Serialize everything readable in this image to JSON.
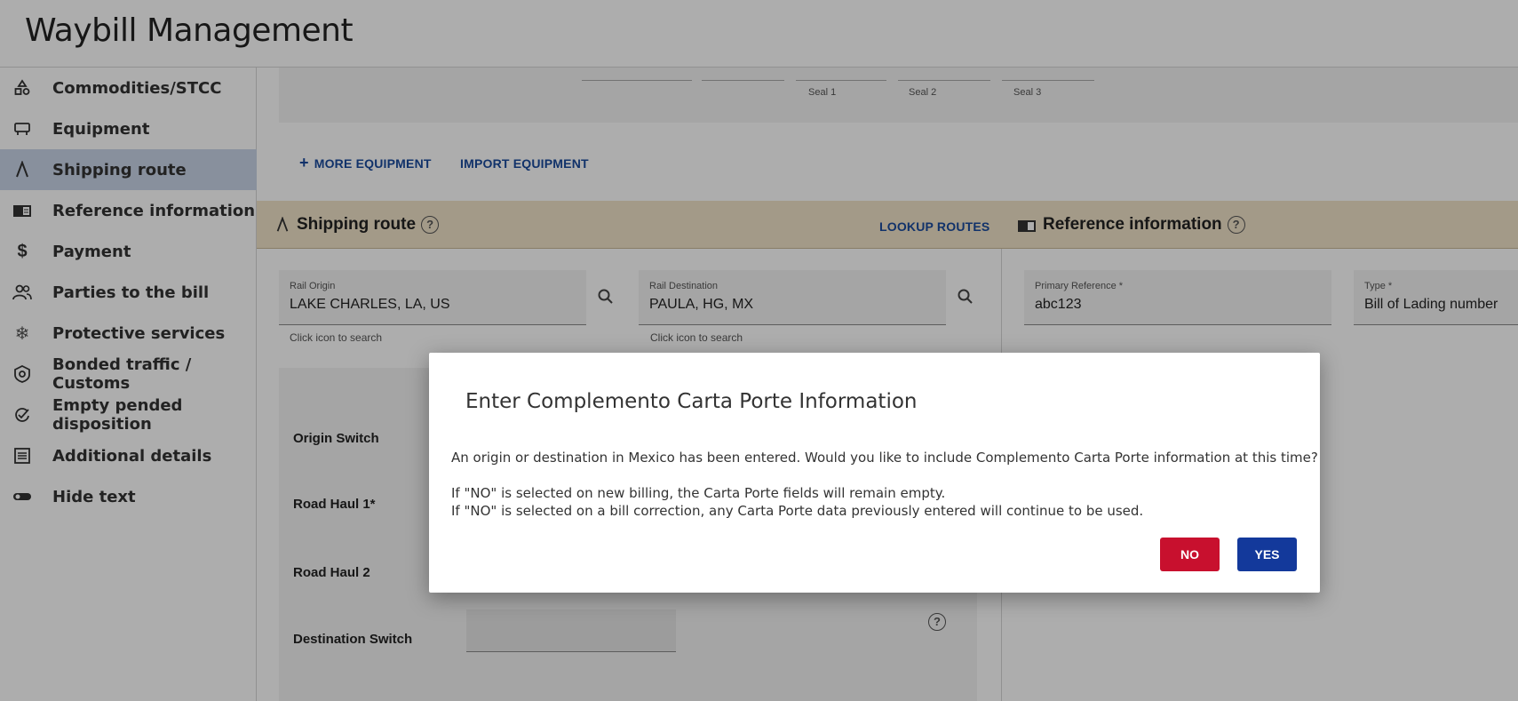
{
  "header": {
    "title": "Waybill Management"
  },
  "sidebar": {
    "items": [
      {
        "label": "Commodities/STCC",
        "icon": "shapes-icon",
        "active": false
      },
      {
        "label": "Equipment",
        "icon": "railcar-icon",
        "active": false
      },
      {
        "label": "Shipping route",
        "icon": "route-icon",
        "active": true
      },
      {
        "label": "Reference information",
        "icon": "book-icon",
        "active": false
      },
      {
        "label": "Payment",
        "icon": "dollar-icon",
        "active": false
      },
      {
        "label": "Parties to the bill",
        "icon": "people-icon",
        "active": false
      },
      {
        "label": "Protective services",
        "icon": "snowflake-icon",
        "active": false
      },
      {
        "label": "Bonded traffic / Customs",
        "icon": "badge-icon",
        "active": false
      },
      {
        "label": "Empty pended disposition",
        "icon": "check-badge-icon",
        "active": false
      },
      {
        "label": "Additional details",
        "icon": "list-icon",
        "active": false
      },
      {
        "label": "Hide text",
        "icon": "toggle-icon",
        "active": false
      }
    ]
  },
  "equipment": {
    "seals": [
      "Seal 1",
      "Seal 2",
      "Seal 3"
    ],
    "more_equipment": "MORE EQUIPMENT",
    "import_equipment": "IMPORT EQUIPMENT"
  },
  "shipping_route": {
    "title": "Shipping route",
    "lookup": "LOOKUP ROUTES",
    "origin": {
      "label": "Rail Origin",
      "value": "LAKE CHARLES, LA, US",
      "hint": "Click icon to search"
    },
    "destination": {
      "label": "Rail Destination",
      "value": "PAULA, HG, MX",
      "hint": "Click icon to search"
    },
    "rows": [
      "Origin Switch",
      "Road Haul 1*",
      "Road Haul 2",
      "Destination Switch"
    ]
  },
  "reference": {
    "title": "Reference information",
    "primary": {
      "label": "Primary Reference *",
      "value": "abc123"
    },
    "type": {
      "label": "Type *",
      "value": "Bill of Lading number"
    }
  },
  "dialog": {
    "title": "Enter Complemento Carta Porte Information",
    "message": "An origin or destination in Mexico has been entered. Would you like to include Complemento Carta Porte information at this time?",
    "note1": "If \"NO\" is selected on new billing, the Carta Porte fields will remain empty.",
    "note2": "If \"NO\" is selected on a bill correction, any Carta Porte data previously entered will continue to be used.",
    "no_label": "NO",
    "yes_label": "YES"
  },
  "colors": {
    "accent": "#13399b",
    "danger": "#c8102e",
    "section_header": "#f1e3c9",
    "active_nav": "#c9d4e8"
  }
}
